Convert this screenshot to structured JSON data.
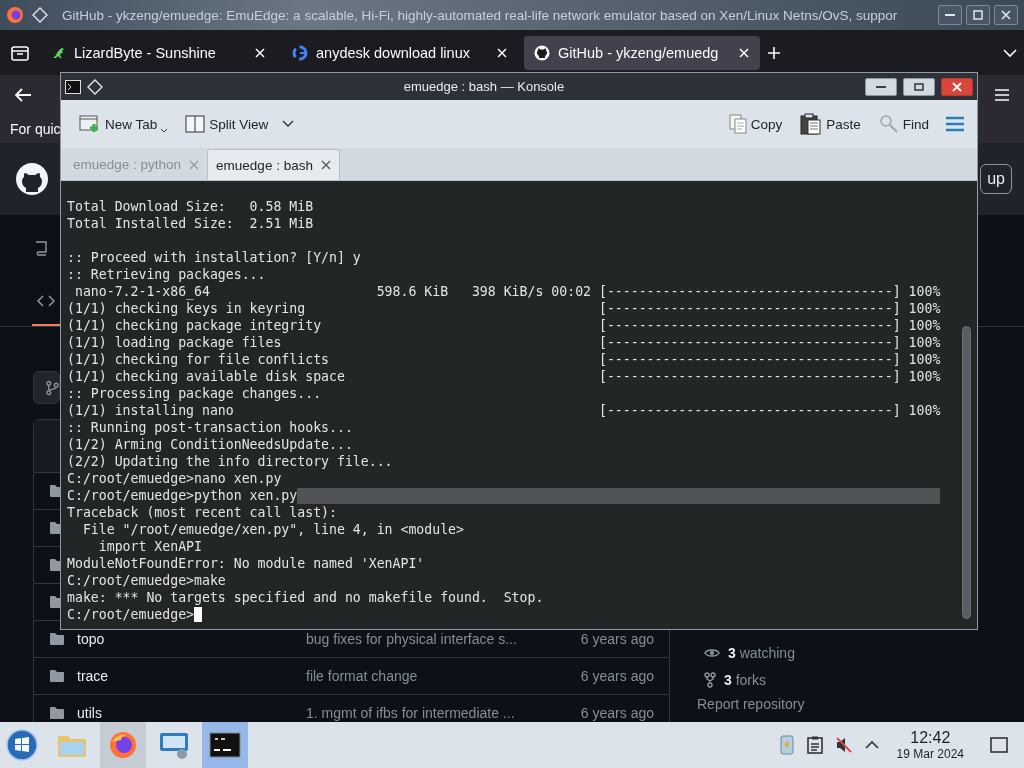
{
  "browser": {
    "window_title": "GitHub - ykzeng/emuedge: EmuEdge: a scalable, Hi-Fi, highly-automated real-life network emulator based on Xen/Linux Netns/OvS, suppor",
    "tabs": [
      {
        "label": "LizardByte - Sunshine",
        "selected": false
      },
      {
        "label": "anydesk download linux",
        "selected": false
      },
      {
        "label": "GitHub - ykzeng/emuedg",
        "selected": true
      }
    ],
    "notice": "For quic"
  },
  "github": {
    "header_button": "up",
    "files": [
      {
        "kind": "folder"
      },
      {
        "kind": "folder"
      },
      {
        "kind": "folder"
      },
      {
        "kind": "folder"
      },
      {
        "kind": "folder",
        "name": "topo",
        "message": "bug fixes for physical interface s...",
        "time": "6 years ago"
      },
      {
        "kind": "folder",
        "name": "trace",
        "message": "file format change",
        "time": "6 years ago"
      },
      {
        "kind": "folder",
        "name": "utils",
        "message": "1. mgmt of ifbs for intermediate ...",
        "time": "6 years ago"
      }
    ],
    "sidebar": [
      {
        "kind": "watching",
        "count": "3",
        "label": "watching"
      },
      {
        "kind": "forks",
        "count": "3",
        "label": "forks"
      }
    ],
    "report_link": "Report repository"
  },
  "konsole": {
    "title": "emuedge : bash — Konsole",
    "toolbar": [
      {
        "kind": "new-tab",
        "label": "New Tab"
      },
      {
        "kind": "split-view",
        "label": "Split View"
      },
      {
        "kind": "copy",
        "label": "Copy"
      },
      {
        "kind": "paste",
        "label": "Paste"
      },
      {
        "kind": "find",
        "label": "Find"
      }
    ],
    "tabs": [
      {
        "label": "emuedge : python",
        "selected": false
      },
      {
        "label": "emuedge : bash",
        "selected": true
      }
    ],
    "lines": [
      {
        "kind": "text",
        "text": "Total Download Size:   0.58 MiB",
        "highlighted": false,
        "cursor": false
      },
      {
        "kind": "text",
        "text": "Total Installed Size:  2.51 MiB",
        "highlighted": false,
        "cursor": false
      },
      {
        "kind": "blank"
      },
      {
        "kind": "text",
        "text": ":: Proceed with installation? [Y/n] y",
        "highlighted": false,
        "cursor": false
      },
      {
        "kind": "text",
        "text": ":: Retrieving packages...",
        "highlighted": false,
        "cursor": false
      },
      {
        "kind": "download",
        "text": " nano-7.2-1-x86_64",
        "stats": "598.6 KiB   398 KiB/s 00:02",
        "bar": "[------------------------------------] 100%"
      },
      {
        "kind": "progress",
        "text": "(1/1) checking keys in keyring",
        "bar": "[------------------------------------] 100%"
      },
      {
        "kind": "progress",
        "text": "(1/1) checking package integrity",
        "bar": "[------------------------------------] 100%"
      },
      {
        "kind": "progress",
        "text": "(1/1) loading package files",
        "bar": "[------------------------------------] 100%"
      },
      {
        "kind": "progress",
        "text": "(1/1) checking for file conflicts",
        "bar": "[------------------------------------] 100%"
      },
      {
        "kind": "progress",
        "text": "(1/1) checking available disk space",
        "bar": "[------------------------------------] 100%"
      },
      {
        "kind": "text",
        "text": ":: Processing package changes...",
        "highlighted": false,
        "cursor": false
      },
      {
        "kind": "progress",
        "text": "(1/1) installing nano",
        "bar": "[------------------------------------] 100%"
      },
      {
        "kind": "text",
        "text": ":: Running post-transaction hooks...",
        "highlighted": false,
        "cursor": false
      },
      {
        "kind": "text",
        "text": "(1/2) Arming ConditionNeedsUpdate...",
        "highlighted": false,
        "cursor": false
      },
      {
        "kind": "text",
        "text": "(2/2) Updating the info directory file...",
        "highlighted": false,
        "cursor": false
      },
      {
        "kind": "text",
        "text": "C:/root/emuedge>nano xen.py",
        "highlighted": false,
        "cursor": false
      },
      {
        "kind": "text",
        "text": "C:/root/emuedge>python xen.py",
        "highlighted": true,
        "cursor": false
      },
      {
        "kind": "text",
        "text": "Traceback (most recent call last):",
        "highlighted": false,
        "cursor": false
      },
      {
        "kind": "text",
        "text": "  File \"/root/emuedge/xen.py\", line 4, in <module>",
        "highlighted": false,
        "cursor": false
      },
      {
        "kind": "text",
        "text": "    import XenAPI",
        "highlighted": false,
        "cursor": false
      },
      {
        "kind": "text",
        "text": "ModuleNotFoundError: No module named 'XenAPI'",
        "highlighted": false,
        "cursor": false
      },
      {
        "kind": "text",
        "text": "C:/root/emuedge>make",
        "highlighted": false,
        "cursor": false
      },
      {
        "kind": "text",
        "text": "make: *** No targets specified and no makefile found.  Stop.",
        "highlighted": false,
        "cursor": false
      },
      {
        "kind": "text",
        "text": "C:/root/emuedge>",
        "highlighted": false,
        "cursor": true
      }
    ]
  },
  "taskbar": {
    "apps": [
      {
        "kind": "files",
        "active": false,
        "hovered": false
      },
      {
        "kind": "firefox",
        "active": false,
        "hovered": true
      },
      {
        "kind": "remote",
        "active": false,
        "hovered": false
      },
      {
        "kind": "terminal",
        "active": true,
        "hovered": false
      }
    ],
    "tray": [
      {
        "kind": "phone"
      },
      {
        "kind": "clipboard"
      },
      {
        "kind": "muted"
      },
      {
        "kind": "expand"
      }
    ],
    "clock": {
      "time": "12:42",
      "date": "19 Mar 2024"
    }
  }
}
